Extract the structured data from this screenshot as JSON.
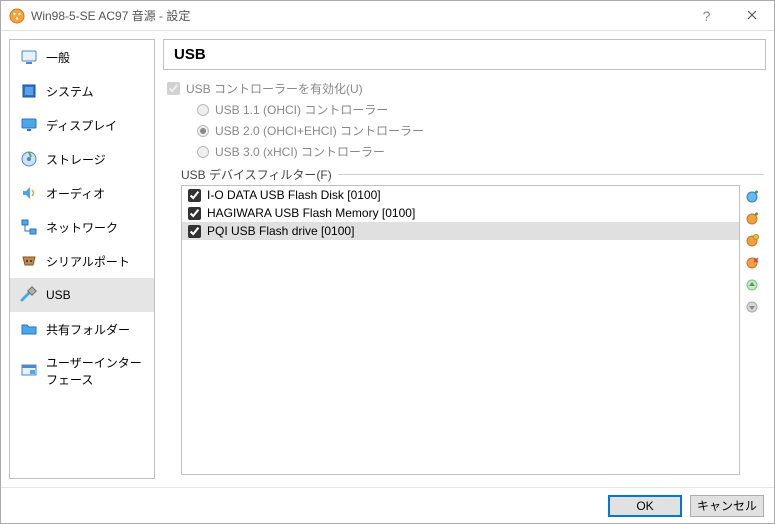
{
  "window": {
    "title": "Win98-5-SE AC97 音源 - 設定"
  },
  "sidebar": {
    "items": [
      {
        "label": "一般"
      },
      {
        "label": "システム"
      },
      {
        "label": "ディスプレイ"
      },
      {
        "label": "ストレージ"
      },
      {
        "label": "オーディオ"
      },
      {
        "label": "ネットワーク"
      },
      {
        "label": "シリアルポート"
      },
      {
        "label": "USB"
      },
      {
        "label": "共有フォルダー"
      },
      {
        "label": "ユーザーインターフェース"
      }
    ]
  },
  "main": {
    "section_title": "USB",
    "enable_label": "USB コントローラーを有効化(U)",
    "radios": {
      "r1": "USB 1.1 (OHCI) コントローラー",
      "r2": "USB 2.0 (OHCI+EHCI) コントローラー",
      "r3": "USB 3.0 (xHCI) コントローラー"
    },
    "filter_label": "USB デバイスフィルター(F)",
    "devices": [
      {
        "label": "I-O DATA USB Flash Disk [0100]"
      },
      {
        "label": "HAGIWARA USB Flash Memory [0100]"
      },
      {
        "label": "PQI USB Flash drive [0100]"
      }
    ]
  },
  "footer": {
    "ok": "OK",
    "cancel": "キャンセル"
  }
}
